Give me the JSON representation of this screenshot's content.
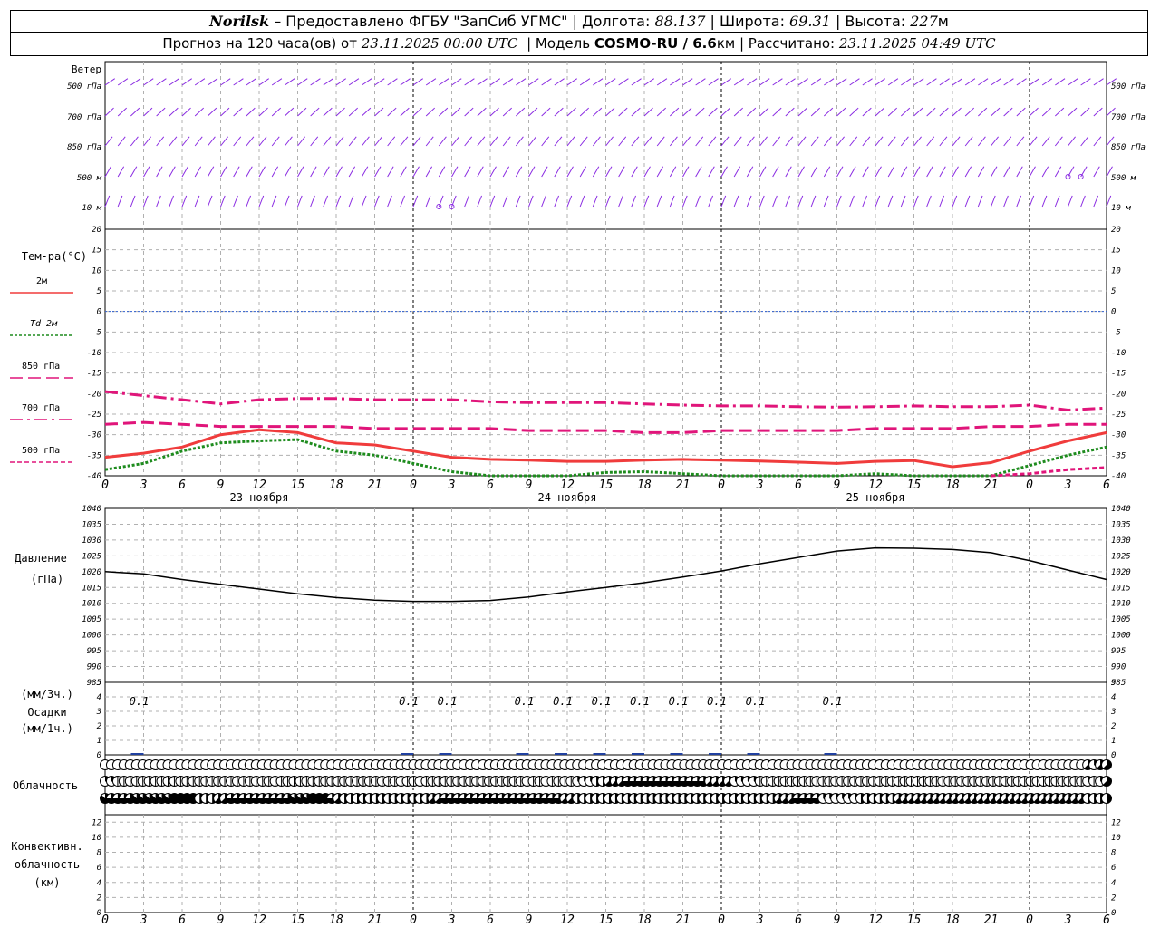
{
  "header": {
    "station": "Norilsk",
    "provider": "– Предоставлено ФГБУ \"ЗапСиб УГМС\"",
    "lon_label": "Долгота:",
    "lon": "88.137",
    "lat_label": "Широта:",
    "lat": "69.31",
    "alt_label": "Высота:",
    "alt": "227",
    "alt_unit": "м",
    "forecast_prefix": "Прогноз на 120 часа(ов) от",
    "forecast_time": "23.11.2025 00:00 UTC",
    "model_label": "Модель",
    "model": "COSMO-RU / 6.6",
    "model_unit": "км",
    "calc_label": "Рассчитано:",
    "calc_time": "23.11.2025 04:49 UTC"
  },
  "chart_data": [
    {
      "type": "wind_barbs",
      "title": "Ветер",
      "levels": [
        "500 гПа",
        "700 гПа",
        "850 гПа",
        "500 м",
        "10 м"
      ],
      "calm_markers": [
        {
          "level": "500 м",
          "hours": [
            75,
            76
          ]
        },
        {
          "level": "10 м",
          "hours": [
            26,
            27
          ]
        }
      ]
    },
    {
      "type": "line",
      "title": "Тем-ра(°C)",
      "ylim": [
        -40,
        20
      ],
      "yticks": [
        20,
        15,
        10,
        5,
        0,
        -5,
        -10,
        -15,
        -20,
        -25,
        -30,
        -35,
        -40
      ],
      "x_hours": [
        0,
        3,
        6,
        9,
        12,
        15,
        18,
        21,
        24,
        27,
        30,
        33,
        36,
        39,
        42,
        45,
        48,
        51,
        54,
        57,
        60,
        63,
        66,
        69,
        72,
        75,
        78
      ],
      "series": [
        {
          "name": "2м",
          "color": "#f03c3c",
          "style": "solid",
          "values": [
            -35.5,
            -34.5,
            -33,
            -30,
            -28.8,
            -29.5,
            -32,
            -32.5,
            -34,
            -35.5,
            -36,
            -36.2,
            -36.5,
            -36.5,
            -36.2,
            -36,
            -36.2,
            -36.4,
            -36.7,
            -37,
            -36.5,
            -36.3,
            -37.8,
            -36.8,
            -34,
            -31.5,
            -29.5
          ]
        },
        {
          "name": "Td 2м",
          "color": "#1e8c1e",
          "style": "dotted",
          "values": [
            -38.5,
            -37,
            -34,
            -32,
            -31.5,
            -31.2,
            -34,
            -35,
            -37,
            -39,
            -40,
            -40.5,
            -40,
            -39.2,
            -39,
            -39.5,
            -40,
            -40.5,
            -40.5,
            -40,
            -39.5,
            -40.5,
            -40.5,
            -40.2,
            -37.5,
            -35,
            -33
          ]
        },
        {
          "name": "850 гПа",
          "color": "#e0157a",
          "style": "longdash",
          "values": [
            -27.5,
            -27,
            -27.5,
            -28,
            -28,
            -28,
            -28,
            -28.5,
            -28.5,
            -28.5,
            -28.5,
            -29,
            -29,
            -29,
            -29.5,
            -29.5,
            -29,
            -29,
            -29,
            -29,
            -28.5,
            -28.5,
            -28.5,
            -28,
            -28,
            -27.5,
            -27.5
          ]
        },
        {
          "name": "700 гПа",
          "color": "#e0157a",
          "style": "dashdot",
          "values": [
            -19.5,
            -20.5,
            -21.5,
            -22.5,
            -21.5,
            -21.2,
            -21.2,
            -21.5,
            -21.5,
            -21.5,
            -22,
            -22.2,
            -22.2,
            -22.2,
            -22.5,
            -22.8,
            -23,
            -23,
            -23.2,
            -23.3,
            -23.2,
            -23,
            -23.2,
            -23.2,
            -22.8,
            -24,
            -23.5
          ]
        },
        {
          "name": "500 гПа",
          "color": "#e0157a",
          "style": "dashed",
          "values": [
            null,
            null,
            null,
            null,
            null,
            null,
            null,
            null,
            null,
            null,
            null,
            null,
            null,
            null,
            null,
            null,
            null,
            null,
            null,
            null,
            null,
            null,
            null,
            -40.5,
            -39.5,
            -38.5,
            -38
          ]
        }
      ]
    },
    {
      "type": "line",
      "title": "Давление",
      "ylabel": "(гПа)",
      "ylim": [
        985,
        1040
      ],
      "yticks": [
        1040,
        1035,
        1030,
        1025,
        1020,
        1015,
        1010,
        1005,
        1000,
        995,
        990,
        985
      ],
      "x_hours": [
        0,
        3,
        6,
        9,
        12,
        15,
        18,
        21,
        24,
        27,
        30,
        33,
        36,
        39,
        42,
        45,
        48,
        51,
        54,
        57,
        60,
        63,
        66,
        69,
        72,
        75,
        78
      ],
      "values": [
        1020,
        1019.3,
        1017.5,
        1016,
        1014.5,
        1013,
        1011.8,
        1011,
        1010.6,
        1010.6,
        1010.9,
        1012,
        1013.6,
        1015,
        1016.5,
        1018.3,
        1020.2,
        1022.5,
        1024.5,
        1026.5,
        1027.5,
        1027.4,
        1027,
        1026,
        1023.5,
        1020.5,
        1017.5
      ]
    },
    {
      "type": "bar",
      "title": "Осадки",
      "labels": [
        "(мм/3ч.)",
        "(мм/1ч.)"
      ],
      "ylim": [
        0,
        5
      ],
      "yticks": [
        5,
        4,
        3,
        2,
        1,
        0
      ],
      "values": [
        {
          "hour": 3,
          "value": 0.1
        },
        {
          "hour": 24,
          "value": 0.1
        },
        {
          "hour": 27,
          "value": 0.1
        },
        {
          "hour": 33,
          "value": 0.1
        },
        {
          "hour": 36,
          "value": 0.1
        },
        {
          "hour": 39,
          "value": 0.1
        },
        {
          "hour": 42,
          "value": 0.1
        },
        {
          "hour": 45,
          "value": 0.1
        },
        {
          "hour": 48,
          "value": 0.1
        },
        {
          "hour": 51,
          "value": 0.1
        },
        {
          "hour": 57,
          "value": 0.1
        }
      ]
    },
    {
      "type": "cloud_symbols",
      "title": "Облачность",
      "rows": [
        {
          "level": "high",
          "oktas": [
            0,
            0,
            0,
            0,
            0,
            0,
            0,
            0,
            0,
            0,
            0,
            0,
            0,
            0,
            0,
            0,
            0,
            0,
            0,
            0,
            0,
            0,
            0,
            0,
            0,
            0,
            0,
            0,
            0,
            0,
            0,
            0,
            0,
            0,
            0,
            0,
            0,
            0,
            0,
            0,
            0,
            0,
            0,
            0,
            0,
            0,
            0,
            0,
            0,
            0,
            0,
            0,
            0,
            0,
            0,
            0,
            0,
            0,
            0,
            0,
            0,
            0,
            0,
            0,
            0,
            0,
            0,
            0,
            0,
            0,
            0,
            0,
            0,
            0,
            0,
            0,
            0,
            0,
            0,
            0,
            0,
            0,
            0,
            0,
            0,
            0,
            0,
            0,
            0,
            0,
            0,
            0,
            0,
            0,
            0,
            0,
            0,
            0,
            0,
            0,
            0,
            0,
            0,
            0,
            0,
            0,
            0,
            0,
            0,
            0,
            0,
            0,
            0,
            0,
            0,
            0,
            0,
            0,
            0,
            0,
            0,
            0,
            0,
            0,
            0,
            0,
            0,
            0,
            0,
            0,
            0,
            0,
            0,
            0,
            0,
            0,
            0,
            0,
            0,
            0,
            0,
            0,
            0,
            0,
            0,
            0,
            0,
            0,
            0,
            0,
            0,
            0,
            0,
            0,
            0,
            0,
            5,
            3,
            5,
            5
          ]
        },
        {
          "level": "middle",
          "oktas": [
            3,
            3,
            1,
            1,
            1,
            1,
            1,
            1,
            1,
            1,
            1,
            1,
            1,
            1,
            1,
            1,
            1,
            1,
            1,
            1,
            1,
            1,
            1,
            1,
            1,
            1,
            1,
            1,
            1,
            1,
            1,
            1,
            1,
            1,
            1,
            1,
            1,
            1,
            1,
            1,
            1,
            1,
            1,
            1,
            1,
            1,
            1,
            1,
            1,
            1,
            1,
            1,
            1,
            1,
            1,
            1,
            1,
            1,
            1,
            1,
            1,
            1,
            1,
            1,
            1,
            1,
            1,
            1,
            1,
            1,
            1,
            1,
            1,
            1,
            1,
            3,
            3,
            3,
            4,
            4,
            5,
            5,
            5,
            6,
            6,
            6,
            6,
            6,
            6,
            6,
            6,
            6,
            6,
            6,
            6,
            6,
            5,
            5,
            5,
            5,
            3,
            3,
            3,
            3,
            1,
            1,
            1,
            1,
            1,
            1,
            1,
            1,
            1,
            1,
            1,
            1,
            1,
            1,
            1,
            1,
            1,
            1,
            1,
            1,
            1,
            1,
            1,
            1,
            1,
            1,
            1,
            1,
            1,
            1,
            1,
            1,
            1,
            1,
            1,
            1,
            1,
            1,
            1,
            1,
            1,
            1,
            1,
            1,
            1,
            1,
            1,
            1,
            1,
            1,
            1,
            1,
            3,
            1,
            3,
            5
          ]
        },
        {
          "level": "low",
          "oktas": [
            7,
            6,
            6,
            6,
            6,
            7,
            7,
            7,
            7,
            7,
            7,
            8,
            8,
            8,
            8,
            4,
            4,
            4,
            5,
            5,
            6,
            6,
            6,
            6,
            6,
            6,
            6,
            6,
            6,
            6,
            7,
            7,
            7,
            8,
            8,
            8,
            6,
            5,
            4,
            4,
            4,
            4,
            4,
            4,
            4,
            4,
            4,
            4,
            4,
            4,
            4,
            4,
            5,
            5,
            6,
            6,
            6,
            6,
            6,
            6,
            6,
            6,
            6,
            6,
            6,
            6,
            6,
            6,
            6,
            6,
            6,
            6,
            6,
            5,
            5,
            4,
            4,
            4,
            4,
            4,
            4,
            4,
            4,
            4,
            4,
            4,
            4,
            4,
            4,
            4,
            4,
            4,
            4,
            4,
            4,
            4,
            4,
            4,
            4,
            4,
            4,
            4,
            4,
            4,
            4,
            4,
            4,
            5,
            5,
            5,
            6,
            6,
            6,
            6,
            3,
            3,
            3,
            3,
            3,
            3,
            4,
            4,
            4,
            4,
            4,
            4,
            5,
            5,
            5,
            5,
            5,
            5,
            5,
            5,
            5,
            5,
            5,
            5,
            5,
            5,
            5,
            5,
            5,
            5,
            5,
            5,
            5,
            5,
            5,
            5,
            5,
            5,
            5,
            5,
            5,
            5,
            4,
            4,
            4,
            4
          ]
        }
      ]
    },
    {
      "type": "bar",
      "title": "Конвективн. облачность",
      "ylabel": "(км)",
      "ylim": [
        0,
        13
      ],
      "yticks": [
        12,
        10,
        8,
        6,
        4,
        2,
        0
      ],
      "values": []
    }
  ],
  "axis": {
    "hour_labels": [
      "0",
      "3",
      "6",
      "9",
      "12",
      "15",
      "18",
      "21",
      "0",
      "3",
      "6",
      "9",
      "12",
      "15",
      "18",
      "21",
      "0",
      "3",
      "6",
      "9",
      "12",
      "15",
      "18",
      "21",
      "0",
      "3",
      "6"
    ],
    "day_labels": [
      "23 ноября",
      "24 ноября",
      "25 ноября"
    ]
  },
  "colors": {
    "temp2m": "#f03c3c",
    "dew": "#1e8c1e",
    "upper": "#e0157a",
    "wind": "#8a2be2",
    "zero_line": "#3060d0",
    "grid": "#b0b0b0"
  }
}
